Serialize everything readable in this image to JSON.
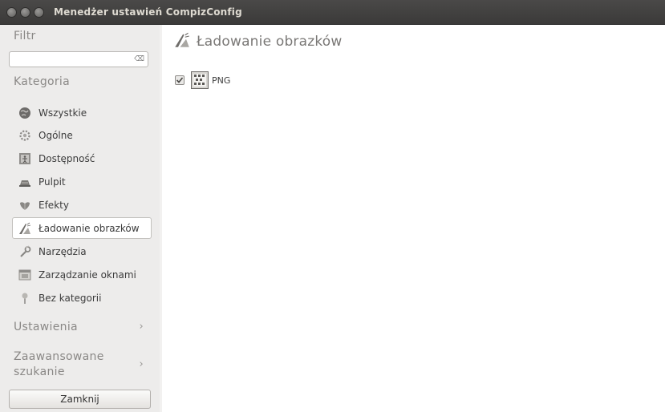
{
  "window": {
    "title": "Menedżer ustawień CompizConfig"
  },
  "sidebar": {
    "filter_label": "Filtr",
    "search": {
      "value": "",
      "placeholder": ""
    },
    "category_label": "Kategoria",
    "categories": [
      {
        "label": "Wszystkie",
        "icon": "globe-icon"
      },
      {
        "label": "Ogólne",
        "icon": "gear-icon"
      },
      {
        "label": "Dostępność",
        "icon": "accessibility-icon"
      },
      {
        "label": "Pulpit",
        "icon": "desktop-icon"
      },
      {
        "label": "Efekty",
        "icon": "effects-icon"
      },
      {
        "label": "Ładowanie obrazków",
        "icon": "image-loading-icon",
        "selected": true
      },
      {
        "label": "Narzędzia",
        "icon": "tools-icon"
      },
      {
        "label": "Zarządzanie oknami",
        "icon": "window-management-icon"
      },
      {
        "label": "Bez kategorii",
        "icon": "uncategorized-icon"
      }
    ],
    "settings_label": "Ustawienia",
    "advanced_search_line1": "Zaawansowane",
    "advanced_search_line2": "szukanie",
    "close_button": "Zamknij"
  },
  "main": {
    "title": "Ładowanie obrazków",
    "plugins": [
      {
        "label": "PNG",
        "checked": true
      }
    ]
  }
}
